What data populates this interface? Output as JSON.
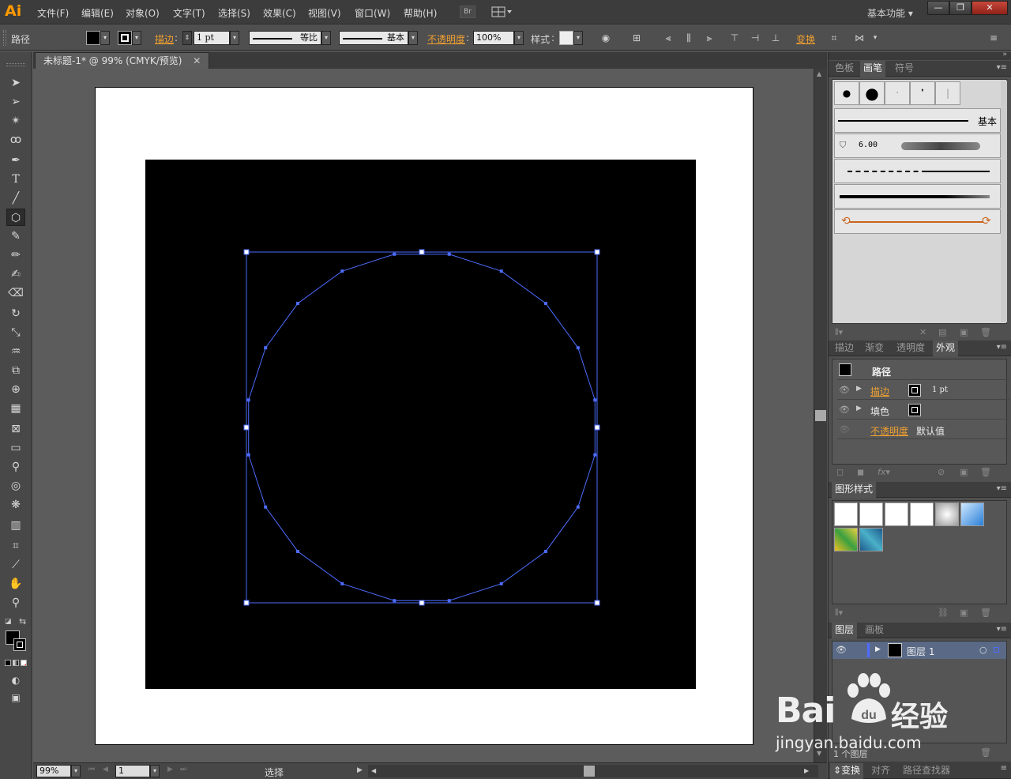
{
  "app": {
    "logo": "Ai",
    "workspace": "基本功能"
  },
  "menu": [
    "文件(F)",
    "编辑(E)",
    "对象(O)",
    "文字(T)",
    "选择(S)",
    "效果(C)",
    "视图(V)",
    "窗口(W)",
    "帮助(H)"
  ],
  "menu_extra": {
    "bridge": "Br"
  },
  "window": {
    "minimize": "—",
    "restore": "❐",
    "close": "✕"
  },
  "control": {
    "selection_label": "路径",
    "stroke_label": "描边",
    "stroke_weight": "1 pt",
    "profile_label": "等比",
    "brush_label": "基本",
    "opacity_label": "不透明度",
    "opacity_value": "100%",
    "style_label": "样式",
    "transform_label": "变换"
  },
  "document": {
    "tab_title": "未标题-1* @ 99% (CMYK/预览)",
    "zoom": "99%",
    "artboard_number": "1",
    "status_text": "选择"
  },
  "colors": {
    "path_selection": "#4d6cff",
    "accent_orange": "#f0a030",
    "canvas_bg": "#5c5c5c",
    "black_rect": "#000000"
  },
  "panels": {
    "top_tabs": [
      "色板",
      "画笔",
      "符号"
    ],
    "top_active": "画笔",
    "brush_row_basic": "基本",
    "brush_size": "6.00",
    "appearance_tabs": [
      "描边",
      "渐变",
      "透明度",
      "外观"
    ],
    "appearance_active": "外观",
    "appearance": {
      "object_label": "路径",
      "stroke_label": "描边",
      "stroke_value": "1 pt",
      "fill_label": "填色",
      "opacity_label": "不透明度",
      "opacity_value": "默认值"
    },
    "graphic_styles_title": "图形样式",
    "layers_tabs": [
      "图层",
      "画板"
    ],
    "layer_name": "图层 1",
    "layers_count": "1 个图层",
    "bottom_tabs": [
      "变换",
      "对齐",
      "路径查找器"
    ]
  },
  "watermark": {
    "brand": "Bai",
    "brand2": "经验",
    "url": "jingyan.baidu.com"
  }
}
